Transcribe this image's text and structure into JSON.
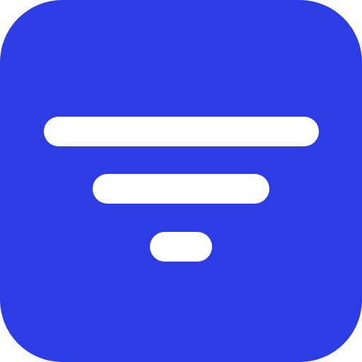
{
  "icon": {
    "name": "filter-icon",
    "background_color": "#2d3de6",
    "line_color": "#ffffff"
  }
}
